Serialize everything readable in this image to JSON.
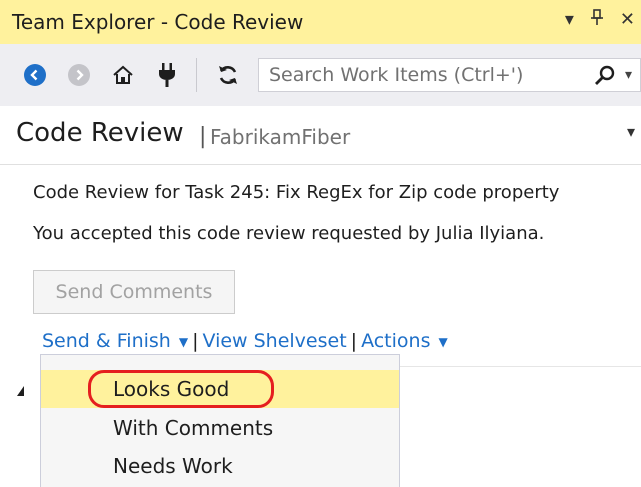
{
  "window": {
    "title": "Team Explorer - Code Review",
    "controls": [
      "▾",
      "⊥",
      "✕"
    ]
  },
  "toolbar": {
    "icons": [
      "back-icon",
      "forward-icon",
      "home-icon",
      "connect-icon",
      "refresh-icon"
    ],
    "search_placeholder": "Search Work Items (Ctrl+')",
    "search_icon": "search-icon",
    "search_dropdown": "▾"
  },
  "header": {
    "title": "Code Review",
    "separator": "|",
    "project": "FabrikamFiber",
    "dropdown": "▾"
  },
  "review": {
    "description": "Code Review for Task 245: Fix RegEx for Zip code property",
    "status": "You accepted this code review requested by Julia Ilyiana."
  },
  "buttons": {
    "send_comments": "Send Comments"
  },
  "links": {
    "send_finish": "Send & Finish",
    "send_finish_caret": "▼",
    "sep1": "|",
    "view_shelveset": "View Shelveset",
    "sep2": "|",
    "actions": "Actions",
    "actions_caret": "▼"
  },
  "menu": {
    "items": [
      {
        "label": "Looks Good",
        "highlighted": true
      },
      {
        "label": "With Comments",
        "highlighted": false
      },
      {
        "label": "Needs Work",
        "highlighted": false
      }
    ]
  },
  "colors": {
    "title_bar": "#fff29d",
    "toolbar": "#eeeef2",
    "link": "#1e6fc8",
    "highlight": "#fff29d",
    "callout": "#e51f1f"
  }
}
